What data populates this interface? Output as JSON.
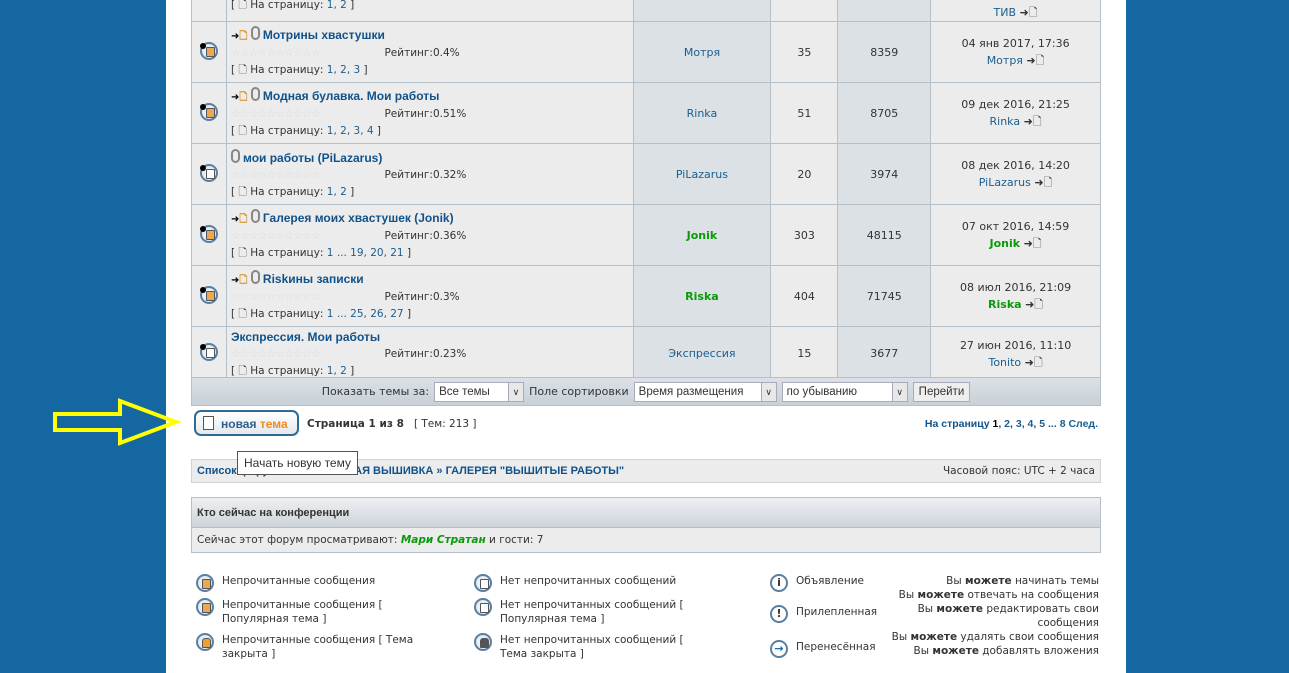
{
  "top_partial_row": {
    "pages_label": "На страницу:",
    "pages": "1, 2",
    "last_author": "ТИВ"
  },
  "topics": [
    {
      "title": "Мотрины хвастушки",
      "new": true,
      "attach": true,
      "rating": "Рейтинг:0.4%",
      "pages": "1, 2, 3",
      "author": "Мотря",
      "author_green": false,
      "replies": "35",
      "views": "8359",
      "last_date": "04 янв 2017, 17:36",
      "last_author": "Мотря",
      "icon": "unread"
    },
    {
      "title": "Модная булавка. Мои работы",
      "new": true,
      "attach": true,
      "rating": "Рейтинг:0.51%",
      "pages": "1, 2, 3, 4",
      "author": "Rinka",
      "author_green": false,
      "replies": "51",
      "views": "8705",
      "last_date": "09 дек 2016, 21:25",
      "last_author": "Rinka",
      "icon": "unread"
    },
    {
      "title": "мои работы (PiLazarus)",
      "new": false,
      "attach": true,
      "rating": "Рейтинг:0.32%",
      "pages": "1, 2",
      "author": "PiLazarus",
      "author_green": false,
      "replies": "20",
      "views": "3974",
      "last_date": "08 дек 2016, 14:20",
      "last_author": "PiLazarus",
      "icon": "read"
    },
    {
      "title": "Галерея моих хвастушек (Jonik)",
      "new": true,
      "attach": true,
      "rating": "Рейтинг:0.36%",
      "pages": "1 ... 19, 20, 21",
      "author": "Jonik",
      "author_green": true,
      "replies": "303",
      "views": "48115",
      "last_date": "07 окт 2016, 14:59",
      "last_author": "Jonik",
      "icon": "unread"
    },
    {
      "title": "Riskины записки",
      "new": true,
      "attach": true,
      "rating": "Рейтинг:0.3%",
      "pages": "1 ... 25, 26, 27",
      "author": "Riska",
      "author_green": true,
      "replies": "404",
      "views": "71745",
      "last_date": "08 июл 2016, 21:09",
      "last_author": "Riska",
      "icon": "unread"
    },
    {
      "title": "Экспрессия. Мои работы",
      "new": false,
      "attach": false,
      "rating": "Рейтинг:0.23%",
      "pages": "1, 2",
      "author": "Экспрессия",
      "author_green": false,
      "replies": "15",
      "views": "3677",
      "last_date": "27 июн 2016, 11:10",
      "last_author": "Tonito",
      "icon": "read"
    }
  ],
  "pages_label": "На страницу:",
  "filter": {
    "show_label": "Показать темы за:",
    "show_value": "Все темы",
    "sort_label": "Поле сортировки",
    "sort_value": "Время размещения",
    "order_value": "по убыванию",
    "go_button": "Перейти"
  },
  "new_topic": {
    "word1": "новая",
    "word2": "тема",
    "tooltip": "Начать новую тему"
  },
  "page_info": {
    "text": "Страница 1 из 8",
    "count": "[ Тем: 213 ]"
  },
  "pagination": {
    "label": "На страницу",
    "pages": [
      "1",
      "2",
      "3",
      "4",
      "5"
    ],
    "ellipsis": "...",
    "last": "8",
    "next": "След."
  },
  "breadcrumbs": {
    "text": "Список форумов » МАШИННАЯ ВЫШИВКА » ГАЛЕРЕЯ \"ВЫШИТЫЕ РАБОТЫ\"",
    "timezone": "Часовой пояс: UTC + 2 часа"
  },
  "who": {
    "title": "Кто сейчас на конференции",
    "prefix": "Сейчас этот форум просматривают:",
    "user": "Мари Стратан",
    "suffix": "и гости: 7"
  },
  "legend": {
    "items": [
      "Непрочитанные сообщения",
      "Непрочитанные сообщения [ Популярная тема ]",
      "Непрочитанные сообщения [ Тема закрыта ]",
      "Нет непрочитанных сообщений",
      "Нет непрочитанных сообщений [ Популярная тема ]",
      "Нет непрочитанных сообщений [ Тема закрыта ]",
      "Объявление",
      "Прилепленная",
      "Перенесённая"
    ],
    "permissions": [
      {
        "pre": "Вы",
        "can": "можете",
        "rest": "начинать темы"
      },
      {
        "pre": "Вы",
        "can": "можете",
        "rest": "отвечать на сообщения"
      },
      {
        "pre": "Вы",
        "can": "можете",
        "rest": "редактировать свои сообщения"
      },
      {
        "pre": "Вы",
        "can": "можете",
        "rest": "удалять свои сообщения"
      },
      {
        "pre": "Вы",
        "can": "можете",
        "rest": "добавлять вложения"
      }
    ]
  },
  "colors": {
    "background": "#1567a2",
    "link": "#105289",
    "green_user": "#0a990a",
    "arrow": "#ffff00"
  }
}
